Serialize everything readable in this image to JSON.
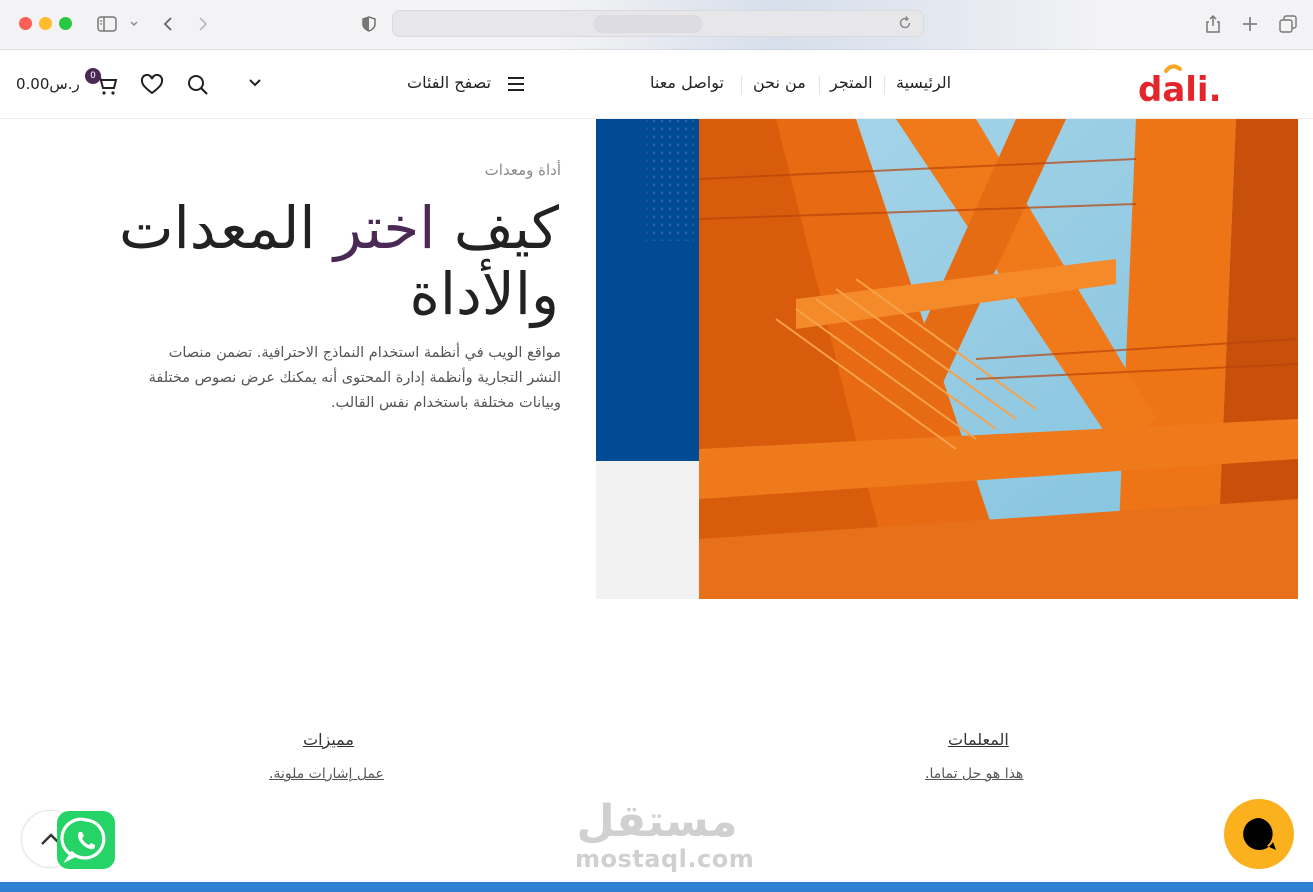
{
  "browser": {
    "icons": [
      "sidebar-icon",
      "chevron-down-icon",
      "back-icon",
      "forward-icon",
      "shield-icon",
      "reload-icon",
      "share-icon",
      "plus-icon",
      "tabs-icon"
    ]
  },
  "header": {
    "logo_text": "dali.",
    "nav": [
      {
        "label": "الرئيسية"
      },
      {
        "label": "المتجر"
      },
      {
        "label": "من نحن"
      },
      {
        "label": "تواصل معنا"
      }
    ],
    "browse_label": "تصفح الفئات",
    "cart_count": "0",
    "cart_total": "0.00ر.س",
    "colors": {
      "accent": "#4a2a55",
      "logo_red": "#e3262b",
      "logo_yellow": "#f5a623"
    }
  },
  "hero": {
    "eyebrow": "أداة ومعدات",
    "headline_part1": "كيف ",
    "headline_accent": "اختر",
    "headline_part2": " المعدات والأداة",
    "description": "مواقع الويب في أنظمة استخدام النماذج الاحترافية. تضمن منصات النشر التجارية وأنظمة إدارة المحتوى أنه يمكنك عرض نصوص مختلفة وبيانات مختلفة باستخدام نفس القالب."
  },
  "features": [
    {
      "title": "المعلمات",
      "subtitle": "هذا هو حل تماما."
    },
    {
      "title": "مميزات",
      "subtitle": "عمل إشارات ملونة."
    }
  ],
  "watermark": {
    "arabic": "مستقل",
    "latin": "mostaql.com"
  },
  "colors": {
    "whatsapp": "#25d366",
    "chat": "#fbb11d",
    "strip": "#2f7fd3"
  }
}
